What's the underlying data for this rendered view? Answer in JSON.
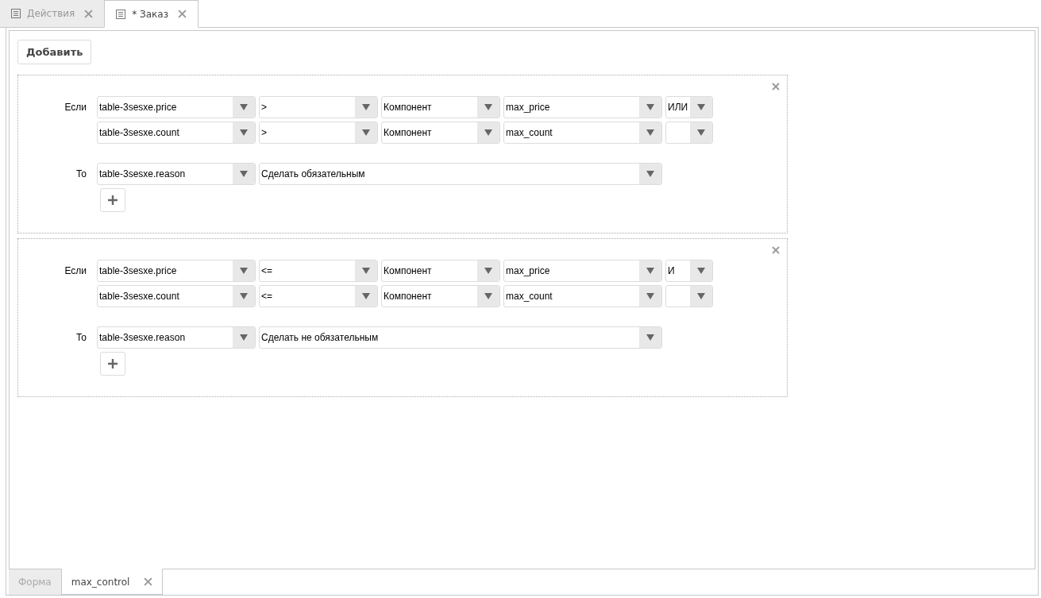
{
  "top_tabs": [
    {
      "label": "Действия",
      "selected": false,
      "closable": true
    },
    {
      "label": "* Заказ",
      "selected": true,
      "closable": true
    }
  ],
  "add_button": "Добавить",
  "rules": [
    {
      "if_label": "Если",
      "conditions": [
        {
          "field": "table-3sesxe.price",
          "operator": ">",
          "source": "Компонент",
          "value": "max_price",
          "conjunction": "ИЛИ"
        },
        {
          "field": "table-3sesxe.count",
          "operator": ">",
          "source": "Компонент",
          "value": "max_count"
        }
      ],
      "then_label": "То",
      "target": "table-3sesxe.reason",
      "action": "Сделать обязательным"
    },
    {
      "if_label": "Если",
      "conditions": [
        {
          "field": "table-3sesxe.price",
          "operator": "<=",
          "source": "Компонент",
          "value": "max_price",
          "conjunction": "И"
        },
        {
          "field": "table-3sesxe.count",
          "operator": "<=",
          "source": "Компонент",
          "value": "max_count"
        }
      ],
      "then_label": "То",
      "target": "table-3sesxe.reason",
      "action": "Сделать не обязательным"
    }
  ],
  "bottom_tabs": [
    {
      "label": "Форма",
      "selected": false,
      "closable": false
    },
    {
      "label": "max_control",
      "selected": true,
      "closable": true
    }
  ]
}
